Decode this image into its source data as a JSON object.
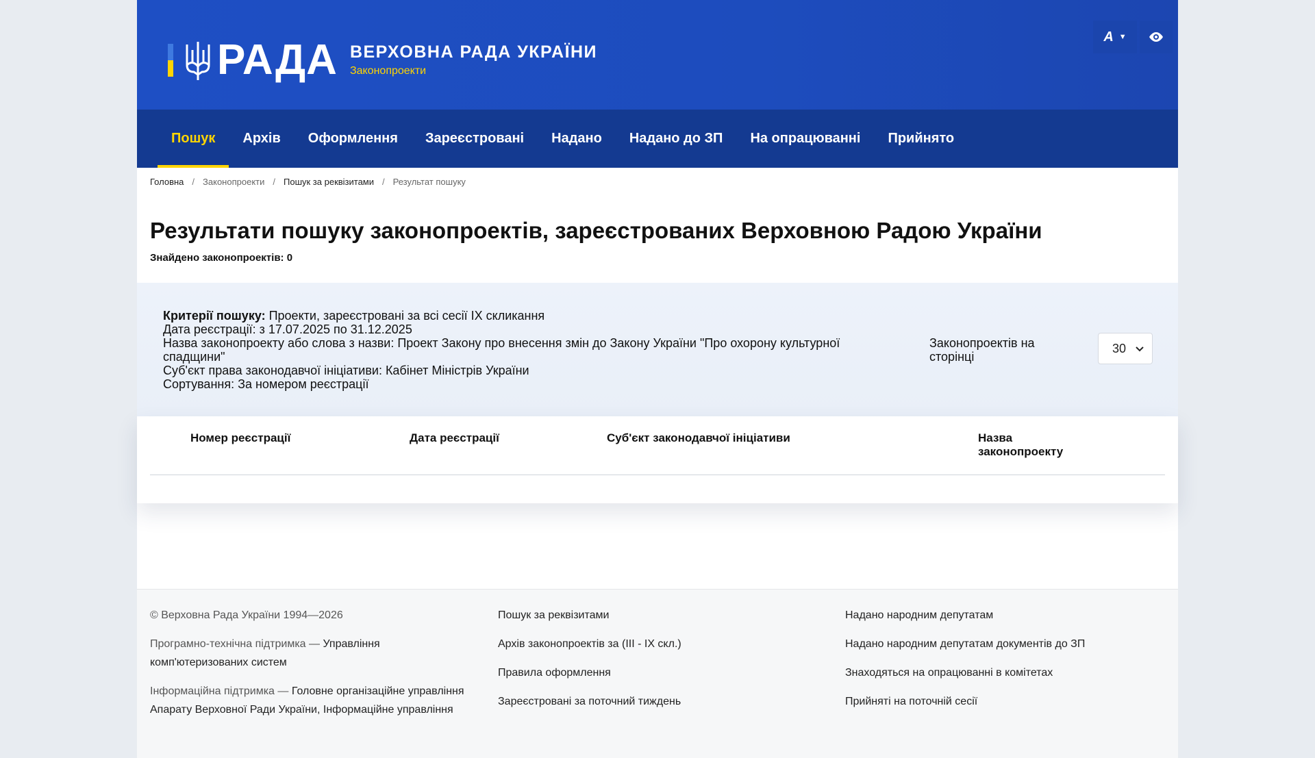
{
  "header": {
    "brand": "РАДА",
    "site_title": "ВЕРХОВНА РАДА УКРАЇНИ",
    "site_subtitle": "Законопроекти",
    "font_tool_label": "A",
    "colors": {
      "primary": "#1e4fc4",
      "nav": "#143a91",
      "accent": "#ffd500"
    }
  },
  "nav": {
    "items": [
      {
        "label": "Пошук",
        "active": true
      },
      {
        "label": "Архів"
      },
      {
        "label": "Оформлення"
      },
      {
        "label": "Зареєстровані"
      },
      {
        "label": "Надано"
      },
      {
        "label": "Надано до ЗП"
      },
      {
        "label": "На опрацюванні"
      },
      {
        "label": "Прийнято"
      }
    ]
  },
  "breadcrumb": {
    "items": [
      "Головна",
      "Законопроекти",
      "Пошук за реквізитами",
      "Результат пошуку"
    ],
    "separator": "/"
  },
  "main": {
    "title": "Результати пошуку законопроектів, зареєстрованих Верховною Радою України",
    "found_label": "Знайдено законопроектів: 0"
  },
  "criteria": {
    "label": "Критерії пошуку:",
    "value": " Проекти, зареєстровані за всі сесії IX скликання",
    "lines": [
      "Дата реєстрації: з 17.07.2025 по 31.12.2025",
      "Назва законопроекту або слова з назви: Проект Закону про внесення змін до Закону України \"Про охорону культурної спадщини\"",
      "Суб'єкт права законодавчої ініціативи: Кабінет Міністрів України",
      "Сортування: За номером реєстрації"
    ],
    "per_page_label": "Законопроектів на сторінці",
    "per_page_value": "30"
  },
  "table": {
    "columns": [
      "Номер реєстрації",
      "Дата реєстрації",
      "Суб'єкт законодавчої ініціативи",
      "Назва законопроекту"
    ]
  },
  "footer": {
    "col1": {
      "copyright": "© Верховна Рада України 1994—2026",
      "tech_label": "Програмно-технічна підтримка — ",
      "tech_value": "Управління комп'ютеризованих систем",
      "info_label": "Інформаційна підтримка — ",
      "info_value": "Головне організаційне управління Апарату Верховної Ради України, Інформаційне управління"
    },
    "col2": [
      "Пошук за реквізитами",
      "Архів законопроектів за (III - IX скл.)",
      "Правила оформлення",
      "Зареєстровані за поточний тиждень"
    ],
    "col3": [
      "Надано народним депутатам",
      "Надано народним депутатам документів до ЗП",
      "Знаходяться на опрацюванні в комітетах",
      "Прийняті на поточній сесії"
    ]
  }
}
